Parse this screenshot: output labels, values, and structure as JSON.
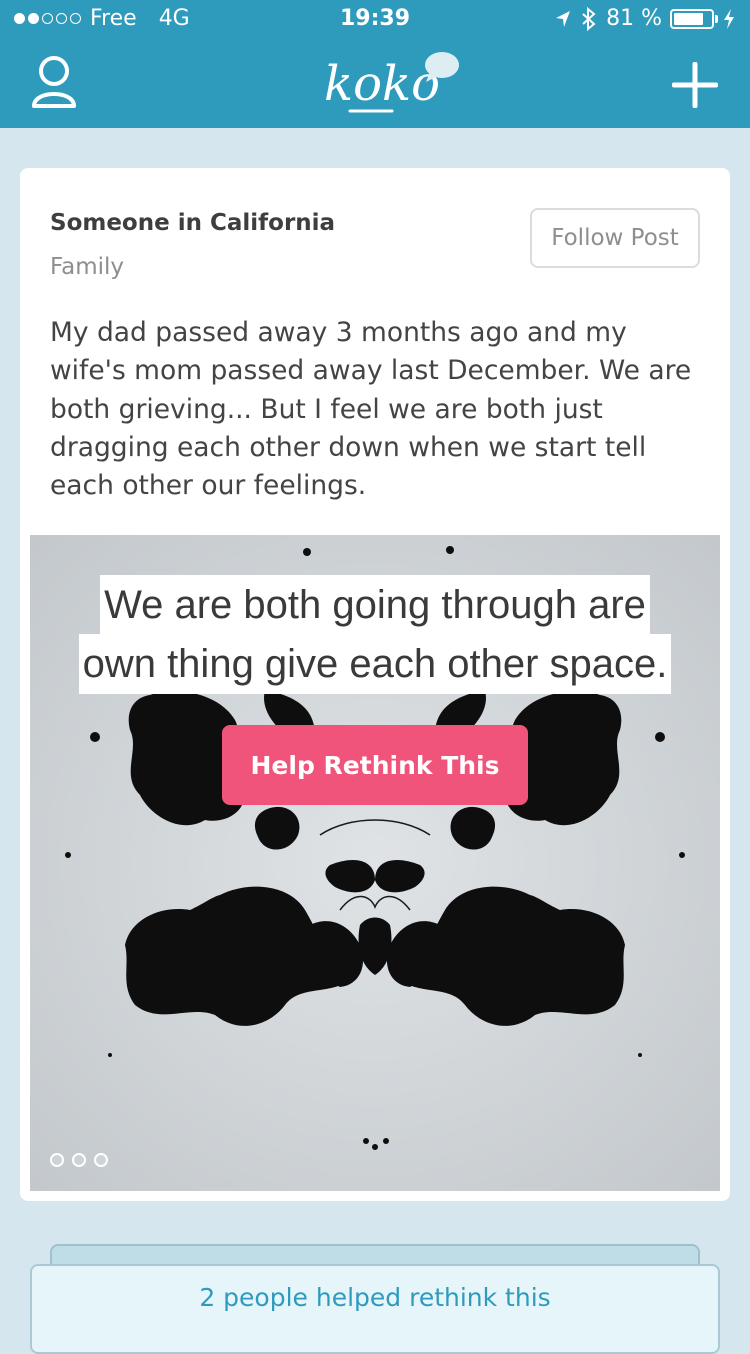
{
  "status_bar": {
    "carrier": "Free",
    "network": "4G",
    "time": "19:39",
    "battery_percent_label": "81 %",
    "battery_level": 0.81,
    "signal_bars_filled": 2,
    "signal_bars_total": 5
  },
  "nav": {
    "logo_text": "koko",
    "profile_icon": "person-icon",
    "add_icon": "plus-icon"
  },
  "post": {
    "author": "Someone in California",
    "category": "Family",
    "follow_label": "Follow Post",
    "body": "My dad passed away 3 months ago and my wife's mom passed away last December. We are both grieving... But I feel we are both just dragging each other down when we start tell each other our feelings.",
    "distortion": {
      "line1": "We are both going through are",
      "line2": "own thing give each other space."
    },
    "help_label": "Help Rethink This",
    "page_dots": 3
  },
  "footer": {
    "helped_text": "2 people helped rethink this"
  },
  "colors": {
    "primary": "#2e9bbd",
    "accent": "#f0547a",
    "background": "#d6e6ee"
  }
}
